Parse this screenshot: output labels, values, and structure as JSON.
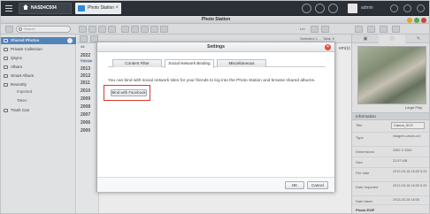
{
  "taskbar": {
    "nas_name": "NASD4C504",
    "app_tab": "Photo Station",
    "user": "admin"
  },
  "window": {
    "title": "Photo Station"
  },
  "toolbar": {
    "search_placeholder": "Search",
    "selected_text": "Selected: 1",
    "total_text": "Total: 9",
    "list_label": "Lm"
  },
  "sidebar": {
    "items": [
      {
        "label": "Shared Photos",
        "icon": "folder-icon"
      },
      {
        "label": "Private Collection",
        "icon": "lock-icon"
      },
      {
        "label": "Qsync",
        "icon": "sync-icon"
      },
      {
        "label": "Album",
        "icon": "album-icon"
      },
      {
        "label": "Smart Album",
        "icon": "smart-album-icon"
      },
      {
        "label": "Recently",
        "icon": "clock-icon"
      },
      {
        "label": "Trash Can",
        "icon": "trash-icon"
      }
    ],
    "recent_sub": [
      "Imported",
      "Taken"
    ]
  },
  "timeline": {
    "all_label": "All",
    "selected": "Februar",
    "years": [
      "2022",
      "2013",
      "2012",
      "2011",
      "2010",
      "2009",
      "2008",
      "2007",
      "2006",
      "2000"
    ]
  },
  "content": {
    "partial_label": "em(s)"
  },
  "info_panel": {
    "large_play": "Large Play",
    "header": "Information",
    "rows": [
      {
        "label": "Title",
        "value": "Canon_0CX"
      },
      {
        "label": "Type",
        "value": "image/x-canon-cr2"
      },
      {
        "label": "Dimensions",
        "value": "4352 X 3264"
      },
      {
        "label": "Size",
        "value": "22.57 MB"
      },
      {
        "label": "File date",
        "value": "2013-03-18 16:05 5:23"
      },
      {
        "label": "Date Imported",
        "value": "2013-03-18 16:05 5:23"
      },
      {
        "label": "Date taken",
        "value": "2013-03-18 16:05"
      },
      {
        "label": "Photo EXIF",
        "value": ""
      }
    ]
  },
  "dialog": {
    "title": "Settings",
    "tabs": [
      "Content Filter",
      "Social Network Binding",
      "Miscellaneous"
    ],
    "active_tab": 1,
    "body_text": "You can bind with social network sites for your friends to log into the Photo Station and browse shared albums.",
    "bind_button": "Bind with Facebook",
    "ok_label": "OK",
    "cancel_label": "Cancel"
  },
  "colors": {
    "selection_blue": "#5b8fc9",
    "highlight_red": "#d63a2f",
    "close_red": "#e04b3f"
  }
}
